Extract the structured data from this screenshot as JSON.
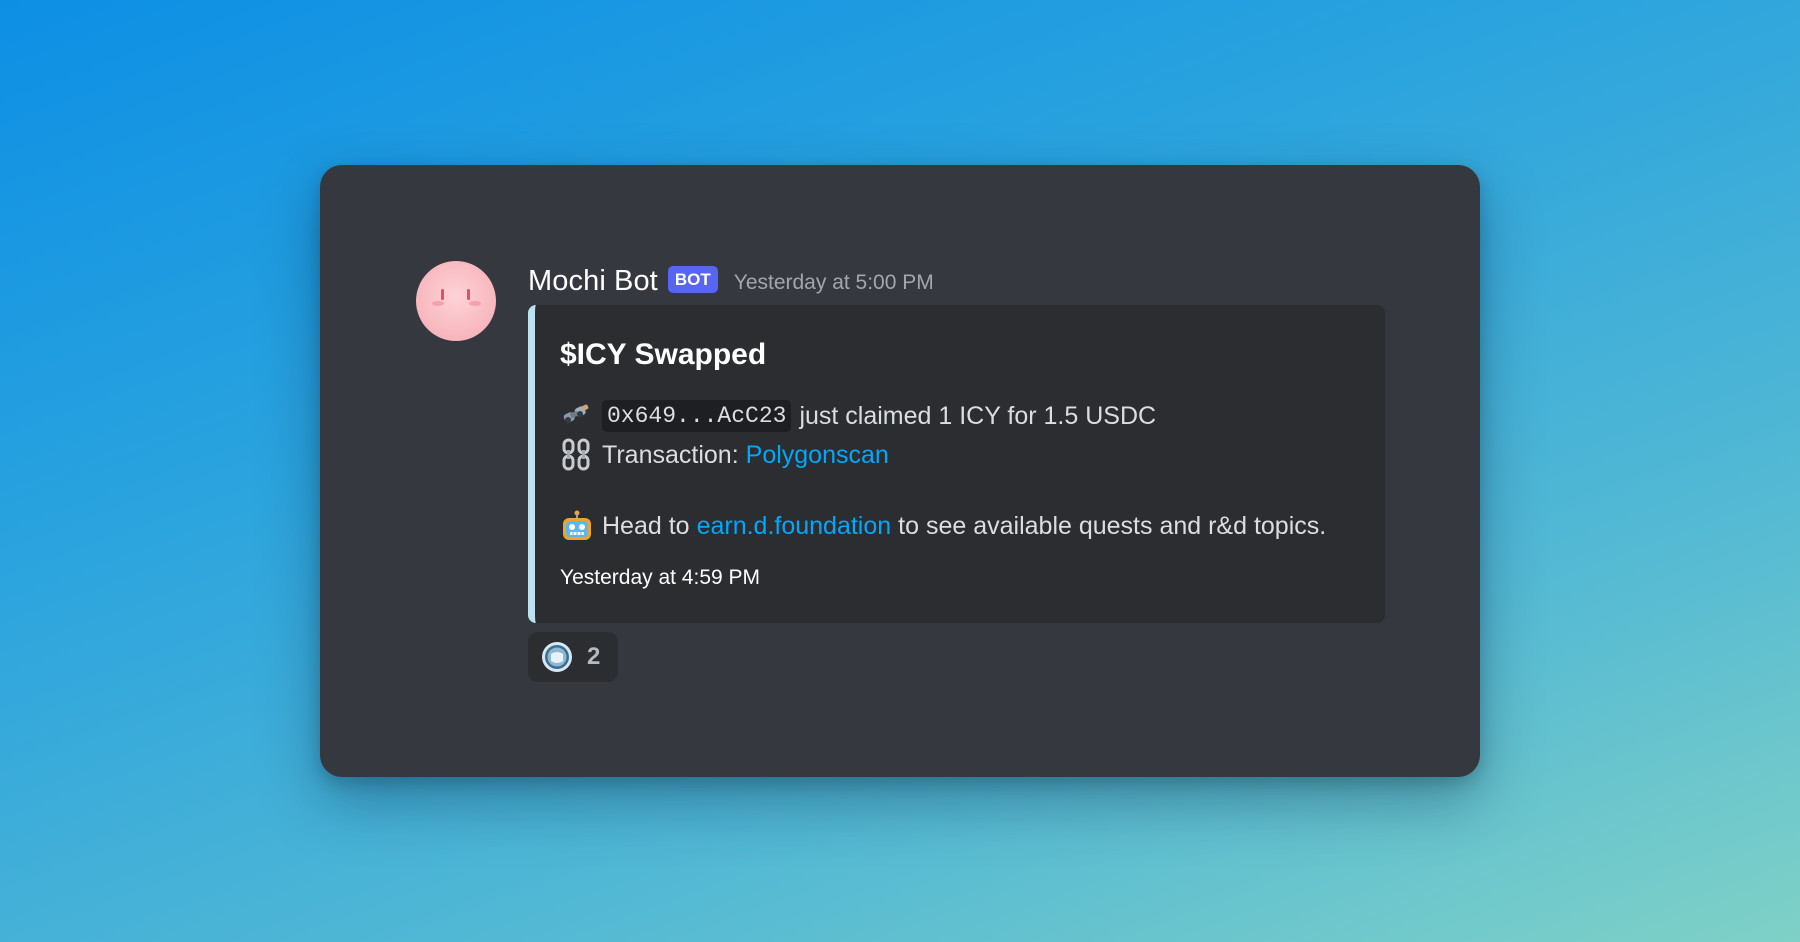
{
  "message": {
    "username": "Mochi Bot",
    "badge": "BOT",
    "timestamp": "Yesterday at 5:00 PM",
    "avatar_icon": "mochi-avatar-icon"
  },
  "embed": {
    "accent_color": "#bde1f0",
    "title": "$ICY Swapped",
    "line1": {
      "icon": "binoculars-icon",
      "address": "0x649...AcC23",
      "text": "just claimed 1 ICY for 1.5 USDC"
    },
    "line2": {
      "icon": "chain-link-icon",
      "label": "Transaction:",
      "link_text": "Polygonscan"
    },
    "line3": {
      "icon": "robot-icon",
      "prefix": "Head to",
      "link_text": "earn.d.foundation",
      "suffix": "to see available quests and r&d topics."
    },
    "footer": "Yesterday at 4:59 PM"
  },
  "reaction": {
    "icon": "icy-token-icon",
    "count": "2"
  },
  "colors": {
    "card_bg": "#363840",
    "embed_bg": "#2b2d31",
    "link": "#00a8fc",
    "badge": "#5865f2"
  }
}
